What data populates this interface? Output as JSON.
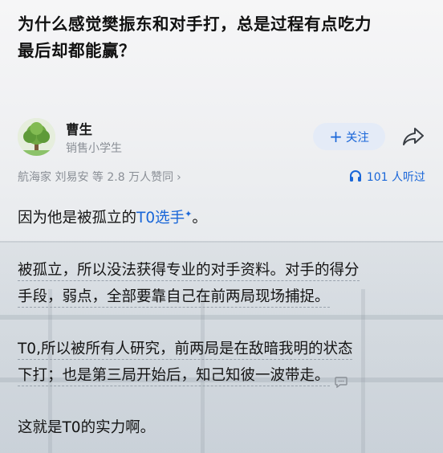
{
  "question": {
    "title_line1": "为什么感觉樊振东和对手打，总是过程有点吃力",
    "title_line2": "最后却都能赢？"
  },
  "author": {
    "name": "曹生",
    "bio": "销售小学生",
    "follow_label": "关注",
    "follow_icon": "plus-icon",
    "share_icon": "share-icon"
  },
  "meta": {
    "endorsements": "航海家 刘易安 等 2.8 万人赞同",
    "chevron": "›",
    "listeners": "101 人听过"
  },
  "answer": {
    "p1_prefix": "因为他是被孤立的",
    "p1_link": "T0选手",
    "p1_sparkle": "✦",
    "p1_suffix": "。",
    "p2_line1": "被孤立，所以没法获得专业的对手资料。对手的得分",
    "p2_line2": "手段，弱点，全部要靠自己在前两局现场捕捉。",
    "p3_line1": "T0,所以被所有人研究，前两局是在敌暗我明的状态",
    "p3_line2": "下打；也是第三局开始后，知己知彼一波带走。",
    "p4": "这就是T0的实力啊。"
  },
  "colors": {
    "accent": "#1966d8",
    "muted": "#8a8f96",
    "follow_bg": "#e4ebf7"
  }
}
